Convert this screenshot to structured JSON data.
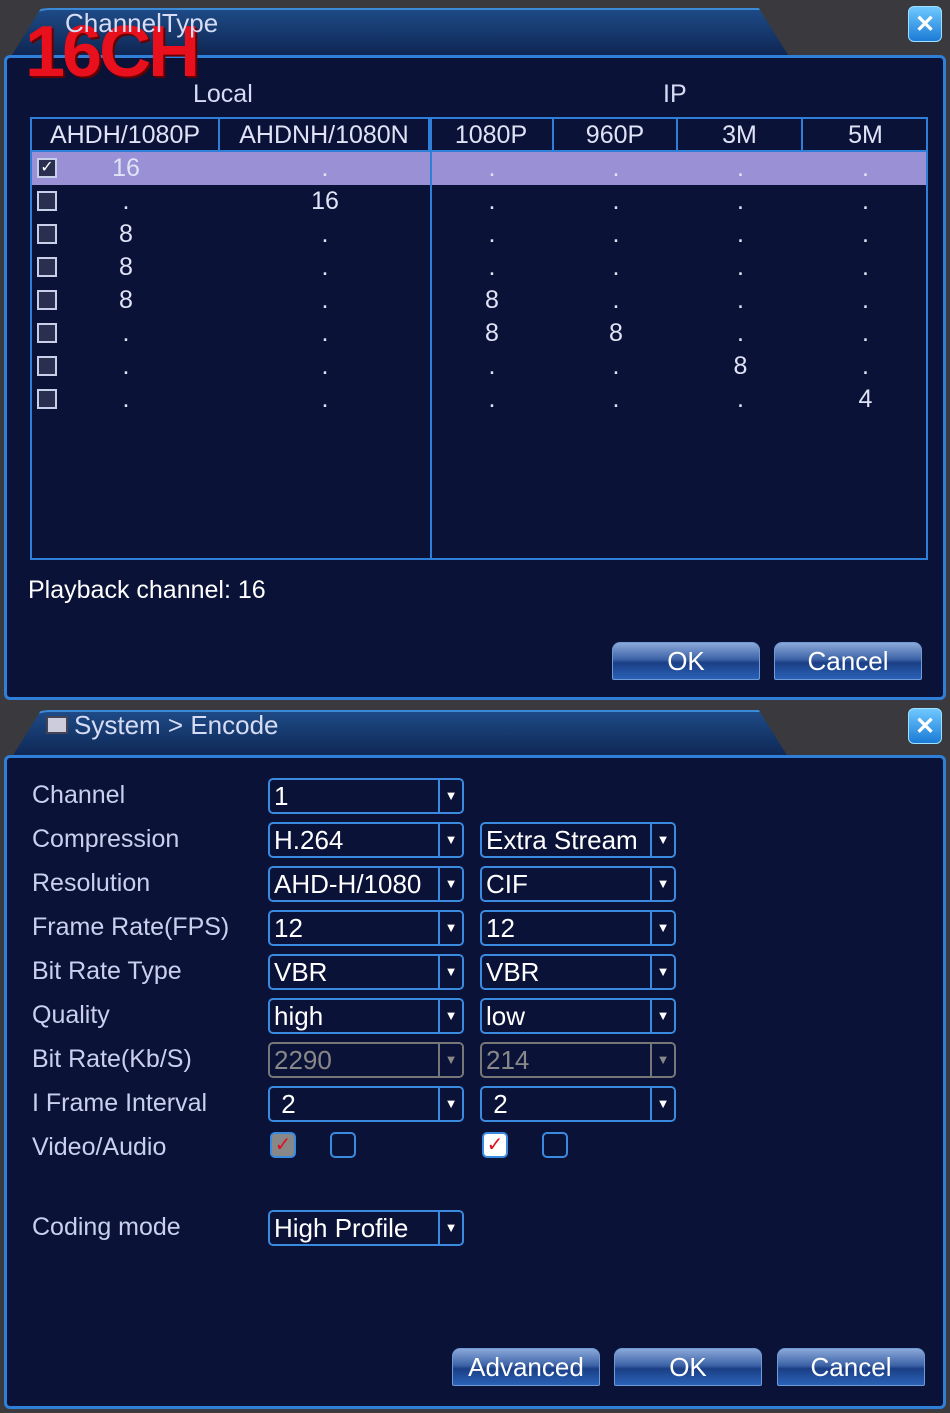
{
  "overlay": {
    "badge": "16CH"
  },
  "channel_type": {
    "title": "ChannelType",
    "groups": [
      "Local",
      "IP"
    ],
    "columns": [
      "AHDH/1080P",
      "AHDNH/1080N",
      "1080P",
      "960P",
      "3M",
      "5M"
    ],
    "rows": [
      {
        "checked": true,
        "values": [
          "16",
          ".",
          ".",
          ".",
          ".",
          "."
        ]
      },
      {
        "checked": false,
        "values": [
          ".",
          "16",
          ".",
          ".",
          ".",
          "."
        ]
      },
      {
        "checked": false,
        "values": [
          "8",
          ".",
          ".",
          ".",
          ".",
          "."
        ]
      },
      {
        "checked": false,
        "values": [
          "8",
          ".",
          ".",
          ".",
          ".",
          "."
        ]
      },
      {
        "checked": false,
        "values": [
          "8",
          ".",
          "8",
          ".",
          ".",
          "."
        ]
      },
      {
        "checked": false,
        "values": [
          ".",
          ".",
          "8",
          "8",
          ".",
          "."
        ]
      },
      {
        "checked": false,
        "values": [
          ".",
          ".",
          ".",
          ".",
          "8",
          "."
        ]
      },
      {
        "checked": false,
        "values": [
          ".",
          ".",
          ".",
          ".",
          ".",
          "4"
        ]
      }
    ],
    "playback": "Playback channel: 16",
    "ok": "OK",
    "cancel": "Cancel"
  },
  "encode": {
    "title": "System > Encode",
    "rows": [
      {
        "label": "Channel",
        "main": "1",
        "extra": null
      },
      {
        "label": "Compression",
        "main": "H.264",
        "extra": "Extra Stream"
      },
      {
        "label": "Resolution",
        "main": "AHD-H/1080",
        "extra": "CIF"
      },
      {
        "label": "Frame Rate(FPS)",
        "main": "12",
        "extra": "12"
      },
      {
        "label": "Bit Rate Type",
        "main": "VBR",
        "extra": "VBR"
      },
      {
        "label": "Quality",
        "main": "high",
        "extra": "low"
      },
      {
        "label": "Bit Rate(Kb/S)",
        "main": "2290",
        "extra": "214",
        "disabled": true
      },
      {
        "label": "I Frame Interval",
        "main": " 2",
        "extra": " 2"
      }
    ],
    "video_audio_label": "Video/Audio",
    "video_audio": {
      "main_video": true,
      "main_audio": false,
      "extra_video": true,
      "extra_audio": false
    },
    "coding_mode_label": "Coding mode",
    "coding_mode": "High Profile",
    "advanced": "Advanced",
    "ok": "OK",
    "cancel": "Cancel"
  }
}
